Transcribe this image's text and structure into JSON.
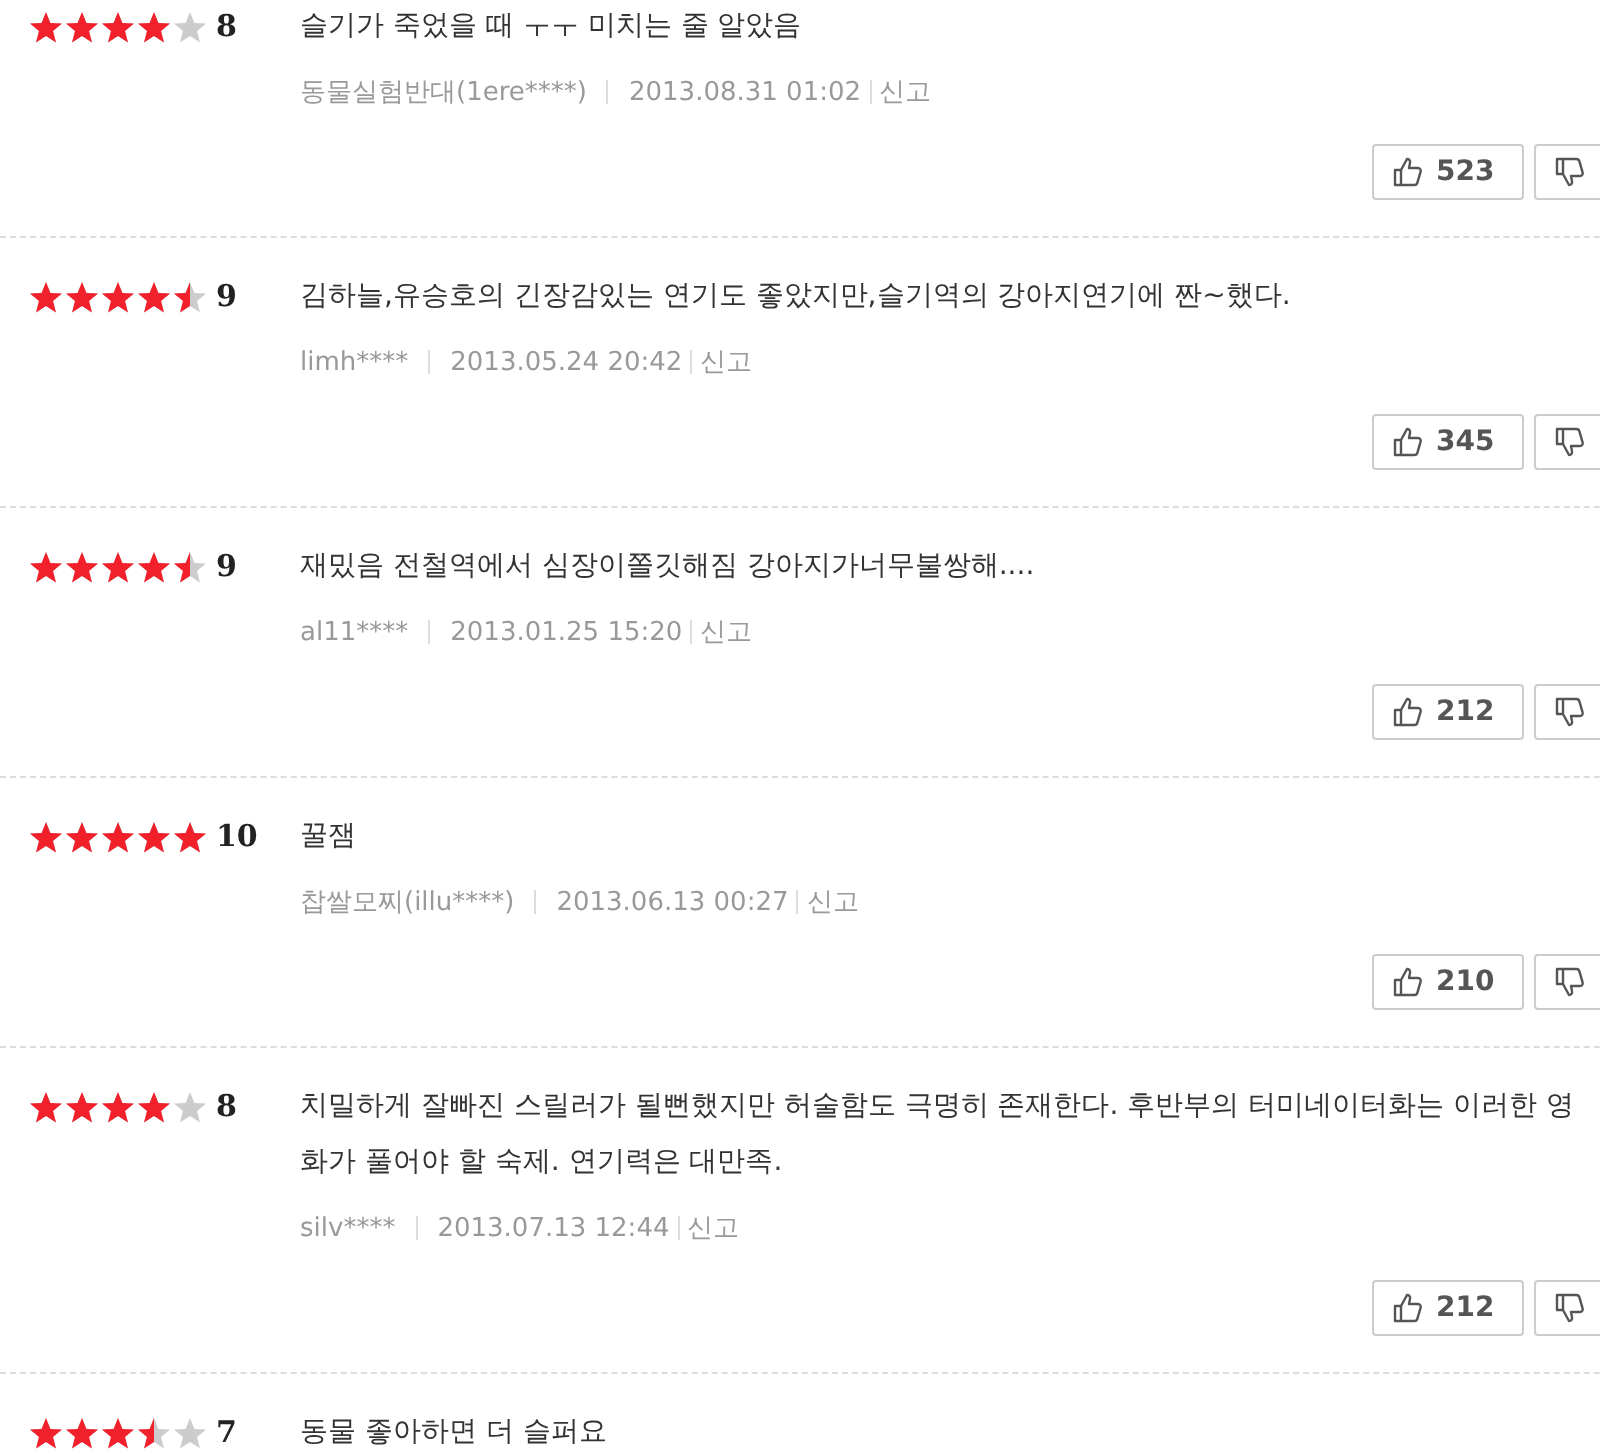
{
  "reviews": [
    {
      "stars": 4,
      "score": "8",
      "text": "슬기가 죽었을 때 ㅜㅜ 미치는 줄 알았음",
      "author": "동물실험반대(1ere****)",
      "date": "2013.08.31 01:02",
      "report": "신고",
      "likes": "523"
    },
    {
      "stars": 4.5,
      "score": "9",
      "text": "김하늘,유승호의 긴장감있는 연기도 좋았지만,슬기역의 강아지연기에 짠~했다.",
      "author": "limh****",
      "date": "2013.05.24 20:42",
      "report": "신고",
      "likes": "345"
    },
    {
      "stars": 4.5,
      "score": "9",
      "text": "재밌음 전철역에서 심장이쫄깃해짐 강아지가너무불쌍해....",
      "author": "al11****",
      "date": "2013.01.25 15:20",
      "report": "신고",
      "likes": "212"
    },
    {
      "stars": 5,
      "score": "10",
      "text": "꿀잼",
      "author": "찹쌀모찌(illu****)",
      "date": "2013.06.13 00:27",
      "report": "신고",
      "likes": "210"
    },
    {
      "stars": 4,
      "score": "8",
      "text": "치밀하게 잘빠진 스릴러가 될뻔했지만 허술함도 극명히 존재한다. 후반부의 터미네이터화는 이러한 영화가 풀어야 할 숙제. 연기력은 대만족.",
      "author": "silv****",
      "date": "2013.07.13 12:44",
      "report": "신고",
      "likes": "212"
    },
    {
      "stars": 3.5,
      "score": "7",
      "text": "동물 좋아하면 더 슬퍼요"
    }
  ]
}
